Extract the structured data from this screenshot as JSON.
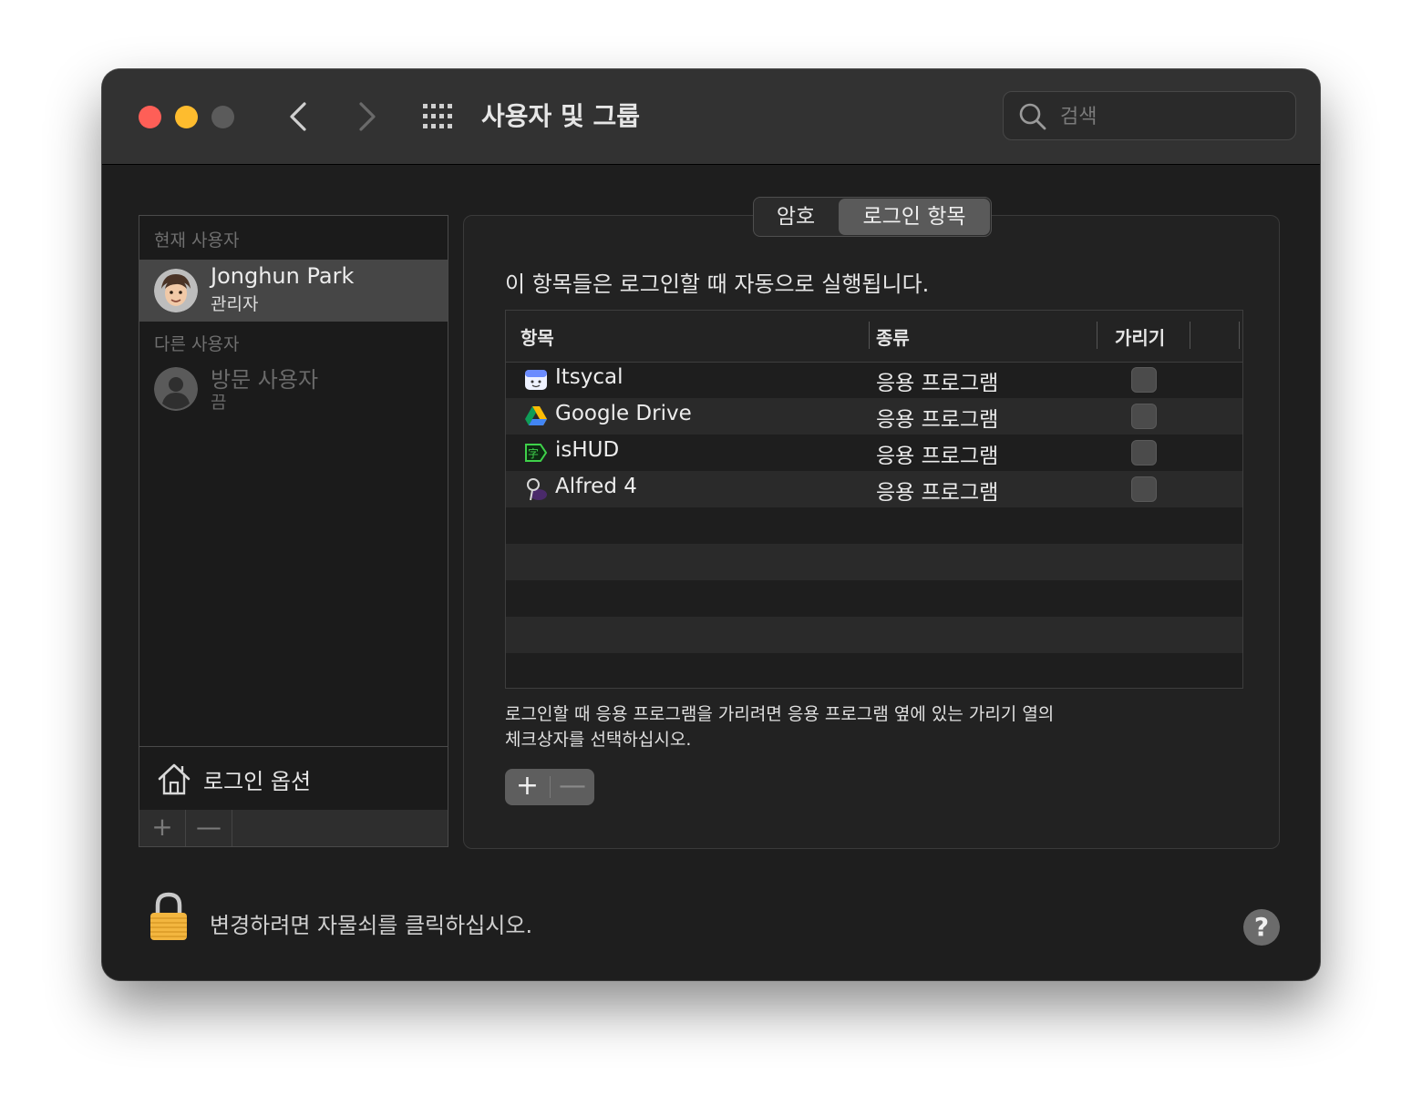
{
  "window": {
    "title": "사용자 및 그룹",
    "search_placeholder": "검색"
  },
  "sidebar": {
    "current_user_label": "현재 사용자",
    "current_user": {
      "name": "Jonghun Park",
      "role": "관리자"
    },
    "other_users_label": "다른 사용자",
    "guest_user": {
      "name": "방문 사용자",
      "status": "끔"
    },
    "login_options_label": "로그인 옵션",
    "add_label": "+",
    "remove_label": "—"
  },
  "tabs": [
    {
      "label": "암호",
      "selected": false
    },
    {
      "label": "로그인 항목",
      "selected": true
    }
  ],
  "main": {
    "description": "이 항목들은 로그인할 때 자동으로 실행됩니다.",
    "columns": {
      "item": "항목",
      "kind": "종류",
      "hide": "가리기"
    },
    "rows": [
      {
        "name": "Itsycal",
        "kind": "응용 프로그램",
        "hide": false,
        "icon": "itsycal-icon"
      },
      {
        "name": "Google Drive",
        "kind": "응용 프로그램",
        "hide": false,
        "icon": "google-drive-icon"
      },
      {
        "name": "isHUD",
        "kind": "응용 프로그램",
        "hide": false,
        "icon": "ishud-icon"
      },
      {
        "name": "Alfred 4",
        "kind": "응용 프로그램",
        "hide": false,
        "icon": "alfred-icon"
      }
    ],
    "hint_line1": "로그인할 때 응용 프로그램을 가리려면 응용 프로그램 옆에 있는 가리기 열의",
    "hint_line2": "체크상자를 선택하십시오.",
    "add_label": "+",
    "remove_label": "—"
  },
  "footer": {
    "lock_text": "변경하려면 자물쇠를 클릭하십시오.",
    "help_label": "?"
  },
  "colors": {
    "close": "#fe5f57",
    "minimize": "#febc2e",
    "zoom_disabled": "#5b5b5b",
    "window_bg": "#1e1e1e",
    "selected_row": "#464646"
  }
}
